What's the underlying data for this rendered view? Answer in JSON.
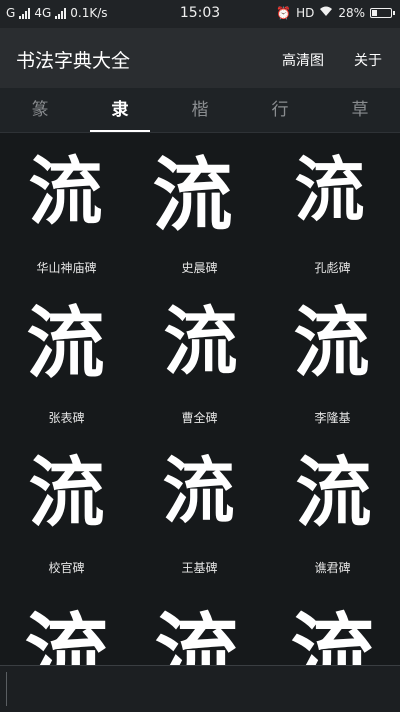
{
  "status_bar": {
    "carrier_1": "G",
    "network": "4G",
    "speed": "0.1K/s",
    "time": "15:03",
    "hd": "HD",
    "battery": "28%",
    "battery_level": 0.28
  },
  "app_bar": {
    "title": "书法字典大全",
    "hd_label": "高清图",
    "about_label": "关于"
  },
  "tabs": [
    {
      "label": "篆",
      "active": false
    },
    {
      "label": "隶",
      "active": true
    },
    {
      "label": "楷",
      "active": false
    },
    {
      "label": "行",
      "active": false
    },
    {
      "label": "草",
      "active": false
    }
  ],
  "character": "流",
  "grid": [
    {
      "label": "华山神庙碑"
    },
    {
      "label": "史晨碑"
    },
    {
      "label": "孔彪碑"
    },
    {
      "label": "张表碑"
    },
    {
      "label": "曹全碑"
    },
    {
      "label": "李隆基"
    },
    {
      "label": "校官碑"
    },
    {
      "label": "王基碑"
    },
    {
      "label": "谯君碑"
    },
    {
      "label": ""
    },
    {
      "label": ""
    },
    {
      "label": ""
    }
  ],
  "colors": {
    "background": "#16191b",
    "app_bar": "#2a2d30",
    "tab_bar": "#1f2326",
    "active_tab": "#ffffff",
    "inactive_tab": "#8a8d90"
  }
}
